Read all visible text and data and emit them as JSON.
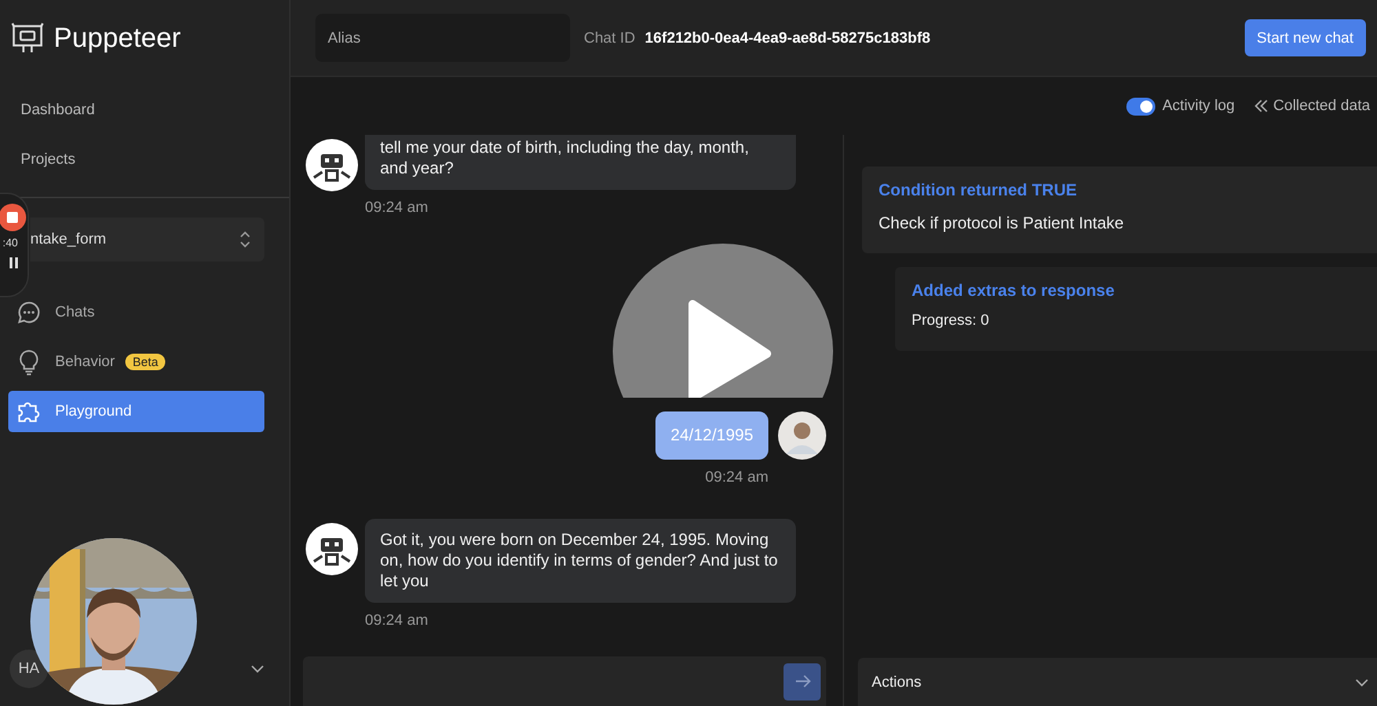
{
  "sidebar": {
    "brand": "Puppeteer",
    "nav": [
      {
        "label": "Dashboard"
      },
      {
        "label": "Projects"
      }
    ],
    "project_select": {
      "value": "ntake_form"
    },
    "menu": [
      {
        "label": "Chats",
        "kind": "chat",
        "selected": false
      },
      {
        "label": "Behavior",
        "kind": "bulb",
        "badge": "Beta",
        "selected": false
      },
      {
        "label": "Playground",
        "kind": "puzzle",
        "selected": true
      }
    ],
    "user": {
      "initials": "HA"
    }
  },
  "recorder": {
    "time": ":40"
  },
  "header": {
    "alias": {
      "placeholder": "Alias"
    },
    "chat_id_label": "Chat ID",
    "chat_id": "16f212b0-0ea4-4ea9-ae8d-58275c183bf8",
    "new_chat_button": "Start new chat"
  },
  "toolbar": {
    "activity_log": {
      "label": "Activity log",
      "on": true
    },
    "collected_data": "Collected data"
  },
  "messages": [
    {
      "kind": "bot",
      "text": "tell me your date of birth, including the day, month, and year?",
      "time": "09:24 am"
    },
    {
      "kind": "user",
      "text": "24/12/1995",
      "time": "09:24 am"
    },
    {
      "kind": "bot",
      "text": "Got it, you were born on December 24, 1995. Moving on, how do you identify in terms of gender? And just to let you",
      "time": "09:24 am"
    }
  ],
  "activity": [
    {
      "title": "Condition returned TRUE",
      "body": "Check if protocol is Patient Intake",
      "children": [
        {
          "title": "Added extras to response",
          "body": "Progress: 0"
        }
      ]
    }
  ],
  "actions": {
    "label": "Actions"
  }
}
